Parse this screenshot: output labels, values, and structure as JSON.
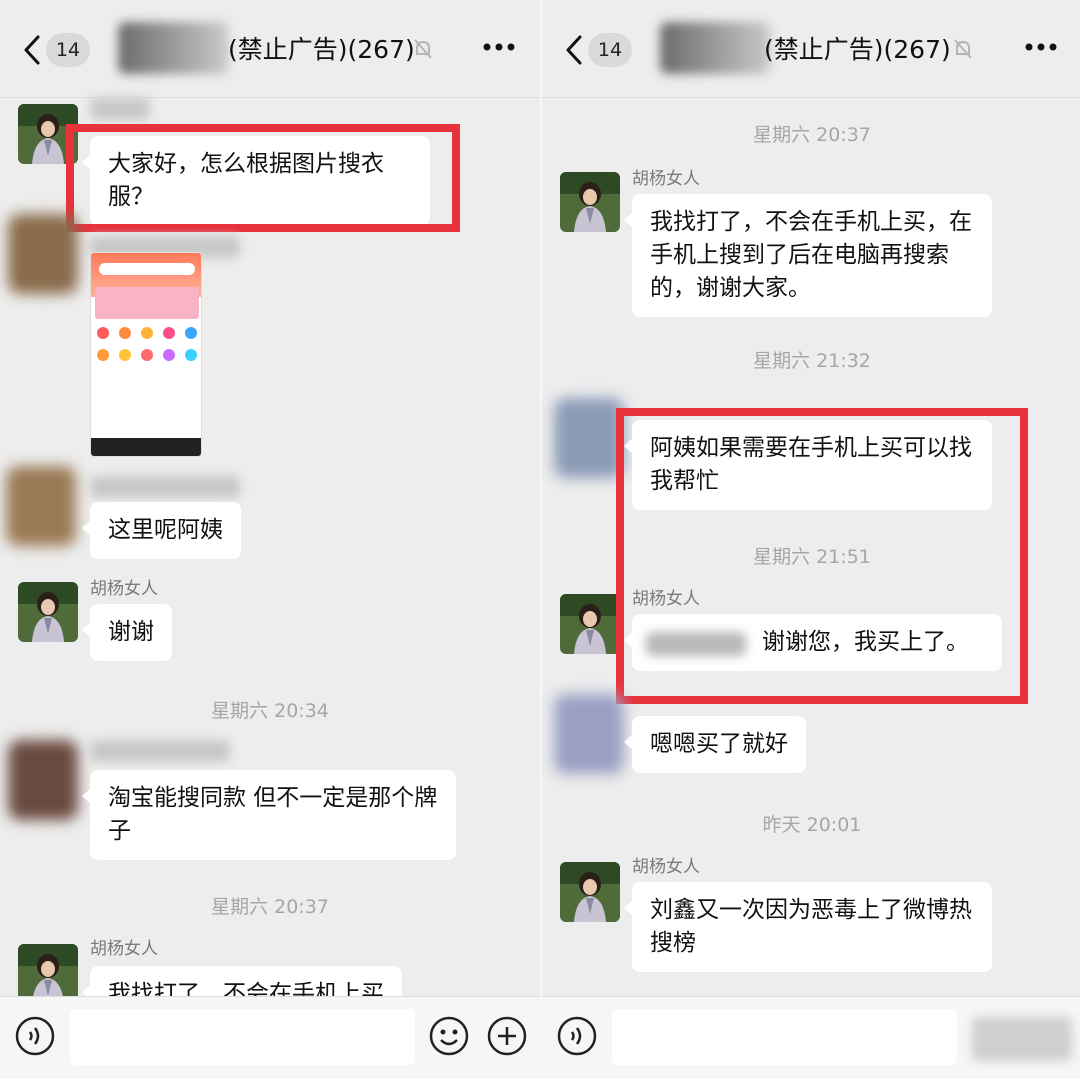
{
  "colors": {
    "background": "#ededed",
    "bubble": "#ffffff",
    "highlight": "#e8323c",
    "timestamp": "#a6a6a6"
  },
  "icons": {
    "back": "chevron-left",
    "mute": "bell-slash",
    "more": "ellipsis",
    "voice": "voice-wave",
    "emoji": "smiley",
    "plus": "plus-circle"
  },
  "left": {
    "header": {
      "unread_count": "14",
      "title": "(禁止广告)(267)"
    },
    "messages": [
      {
        "text": "大家好，怎么根据图片搜衣服？"
      },
      {
        "text": "这里呢阿姨"
      },
      {
        "sender": "胡杨女人",
        "text": "谢谢"
      },
      {
        "timestamp": "星期六 20:34"
      },
      {
        "text": "淘宝能搜同款 但不一定是那个牌子"
      },
      {
        "timestamp": "星期六 20:37"
      },
      {
        "sender": "胡杨女人",
        "text": "我找打了，不会在手机上买"
      }
    ]
  },
  "right": {
    "header": {
      "unread_count": "14",
      "title": "(禁止广告)(267)"
    },
    "messages": [
      {
        "timestamp": "星期六 20:37"
      },
      {
        "sender": "胡杨女人",
        "text": "我找打了，不会在手机上买，在手机上搜到了后在电脑再搜索的，谢谢大家。"
      },
      {
        "timestamp": "星期六 21:32"
      },
      {
        "text": "阿姨如果需要在手机上买可以找我帮忙"
      },
      {
        "timestamp": "星期六 21:51"
      },
      {
        "sender": "胡杨女人",
        "text": "谢谢您，我买上了。"
      },
      {
        "text": "嗯嗯买了就好"
      },
      {
        "timestamp": "昨天 20:01"
      },
      {
        "sender": "胡杨女人",
        "text": "刘鑫又一次因为恶毒上了微博热搜榜"
      }
    ]
  }
}
